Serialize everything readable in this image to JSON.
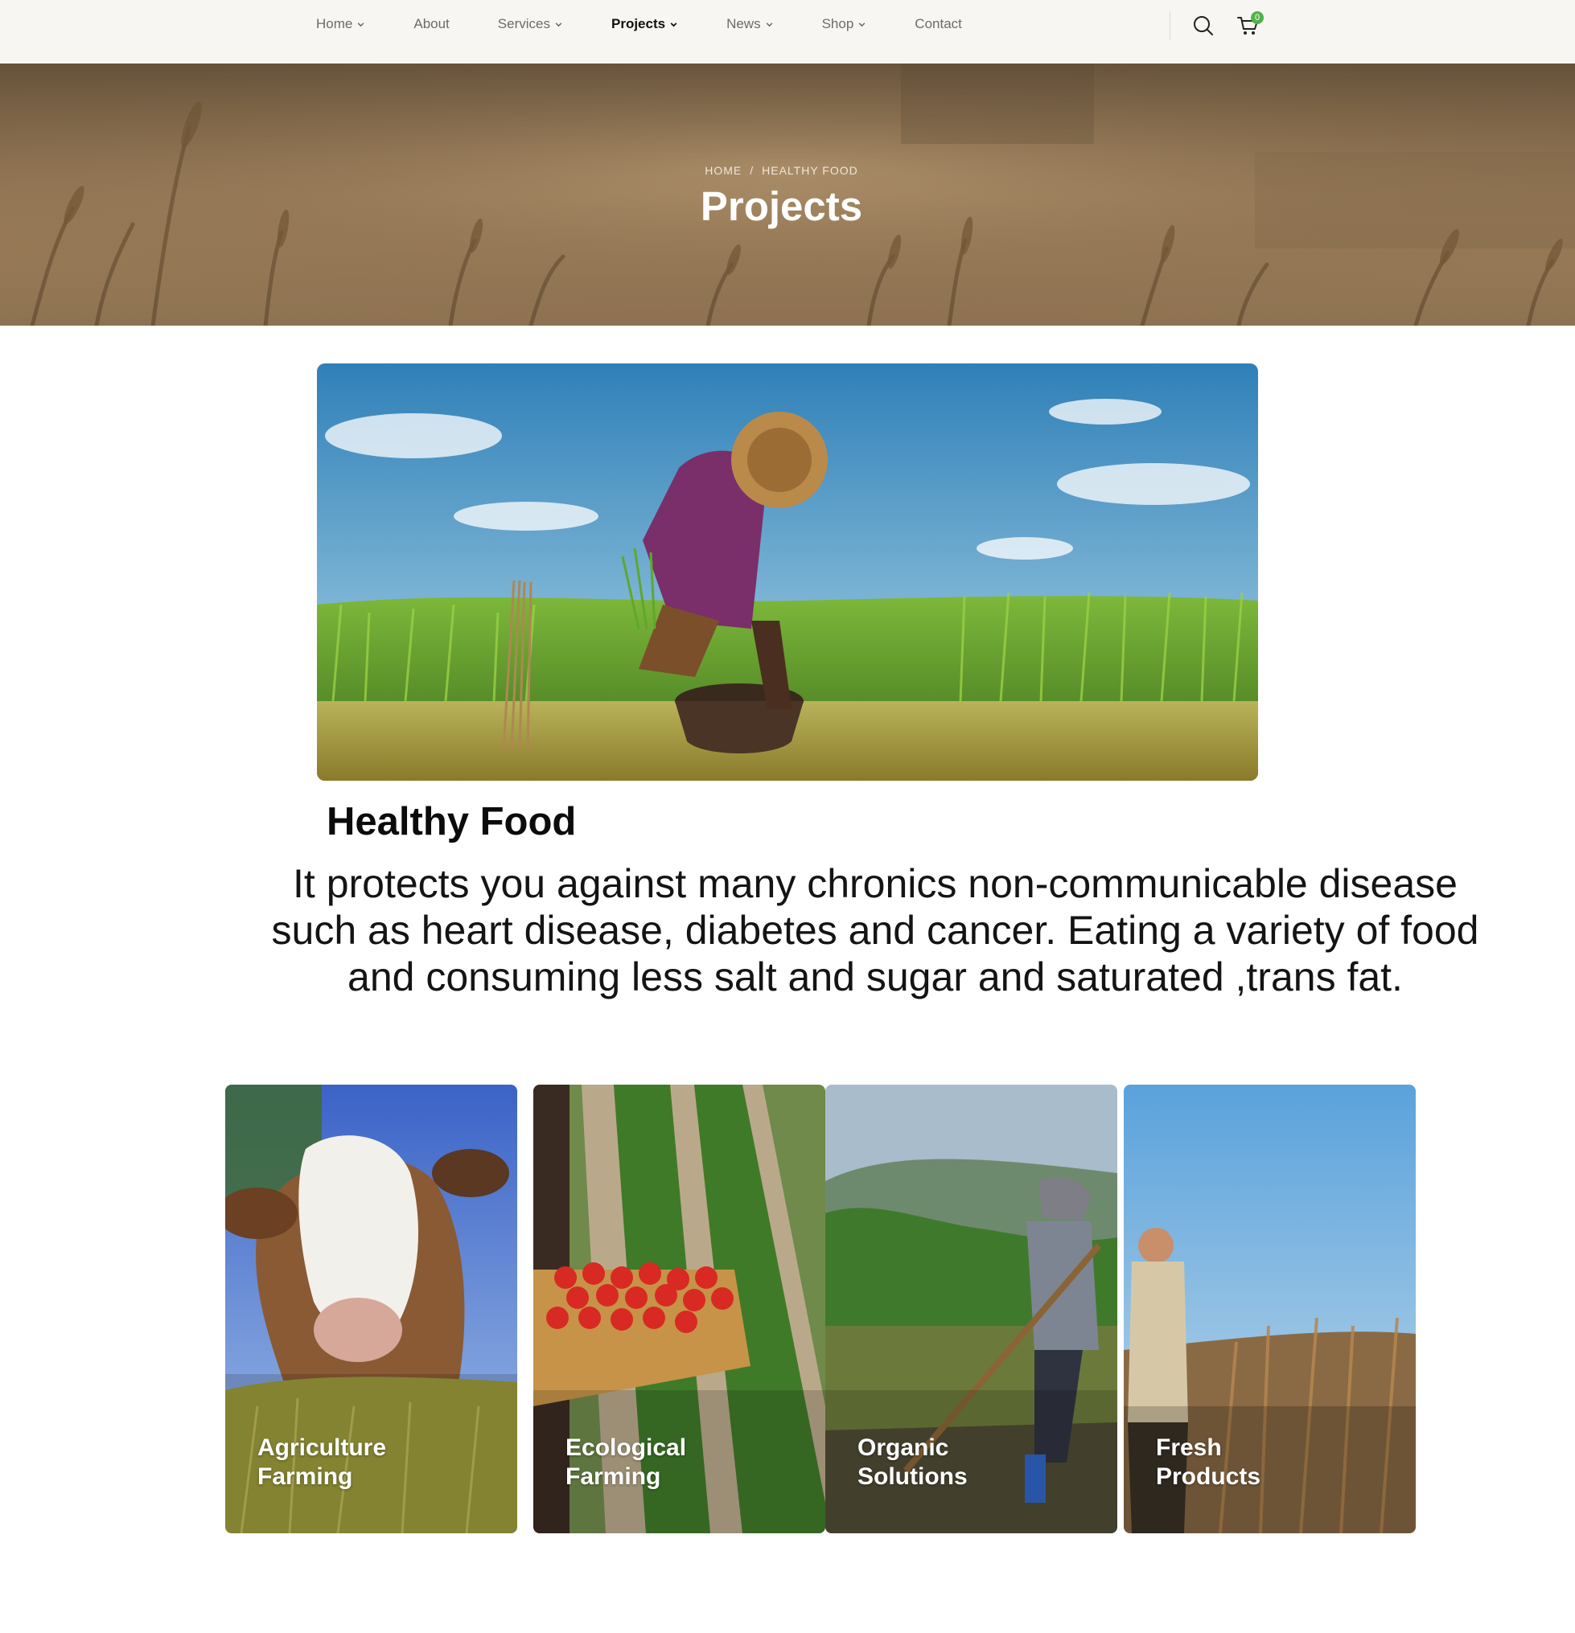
{
  "nav": {
    "items": [
      {
        "label": "Home",
        "has_dropdown": true,
        "active": false
      },
      {
        "label": "About",
        "has_dropdown": false,
        "active": false
      },
      {
        "label": "Services",
        "has_dropdown": true,
        "active": false
      },
      {
        "label": "Projects",
        "has_dropdown": true,
        "active": true
      },
      {
        "label": "News",
        "has_dropdown": true,
        "active": false
      },
      {
        "label": "Shop",
        "has_dropdown": true,
        "active": false
      },
      {
        "label": "Contact",
        "has_dropdown": false,
        "active": false
      }
    ],
    "search_icon": "search-icon",
    "cart_icon": "cart-icon",
    "cart_count": "0"
  },
  "hero": {
    "breadcrumb": {
      "home": "HOME",
      "separator": "/",
      "current": "HEALTHY FOOD"
    },
    "title": "Projects"
  },
  "project": {
    "title": "Healthy Food",
    "description": "It protects you against many chronics non-communicable disease such as heart disease, diabetes and cancer. Eating a variety of food and consuming less salt and sugar and saturated ,trans fat."
  },
  "cards": [
    {
      "line1": "Agriculture",
      "line2": "Farming"
    },
    {
      "line1": "Ecological",
      "line2": "Farming"
    },
    {
      "line1": "Organic",
      "line2": "Solutions"
    },
    {
      "line1": "Fresh",
      "line2": "Products"
    }
  ],
  "colors": {
    "accent_green": "#4fb34a",
    "header_bg": "#f7f6f2",
    "text_dark": "#111111",
    "nav_text": "#6b6b6b"
  }
}
